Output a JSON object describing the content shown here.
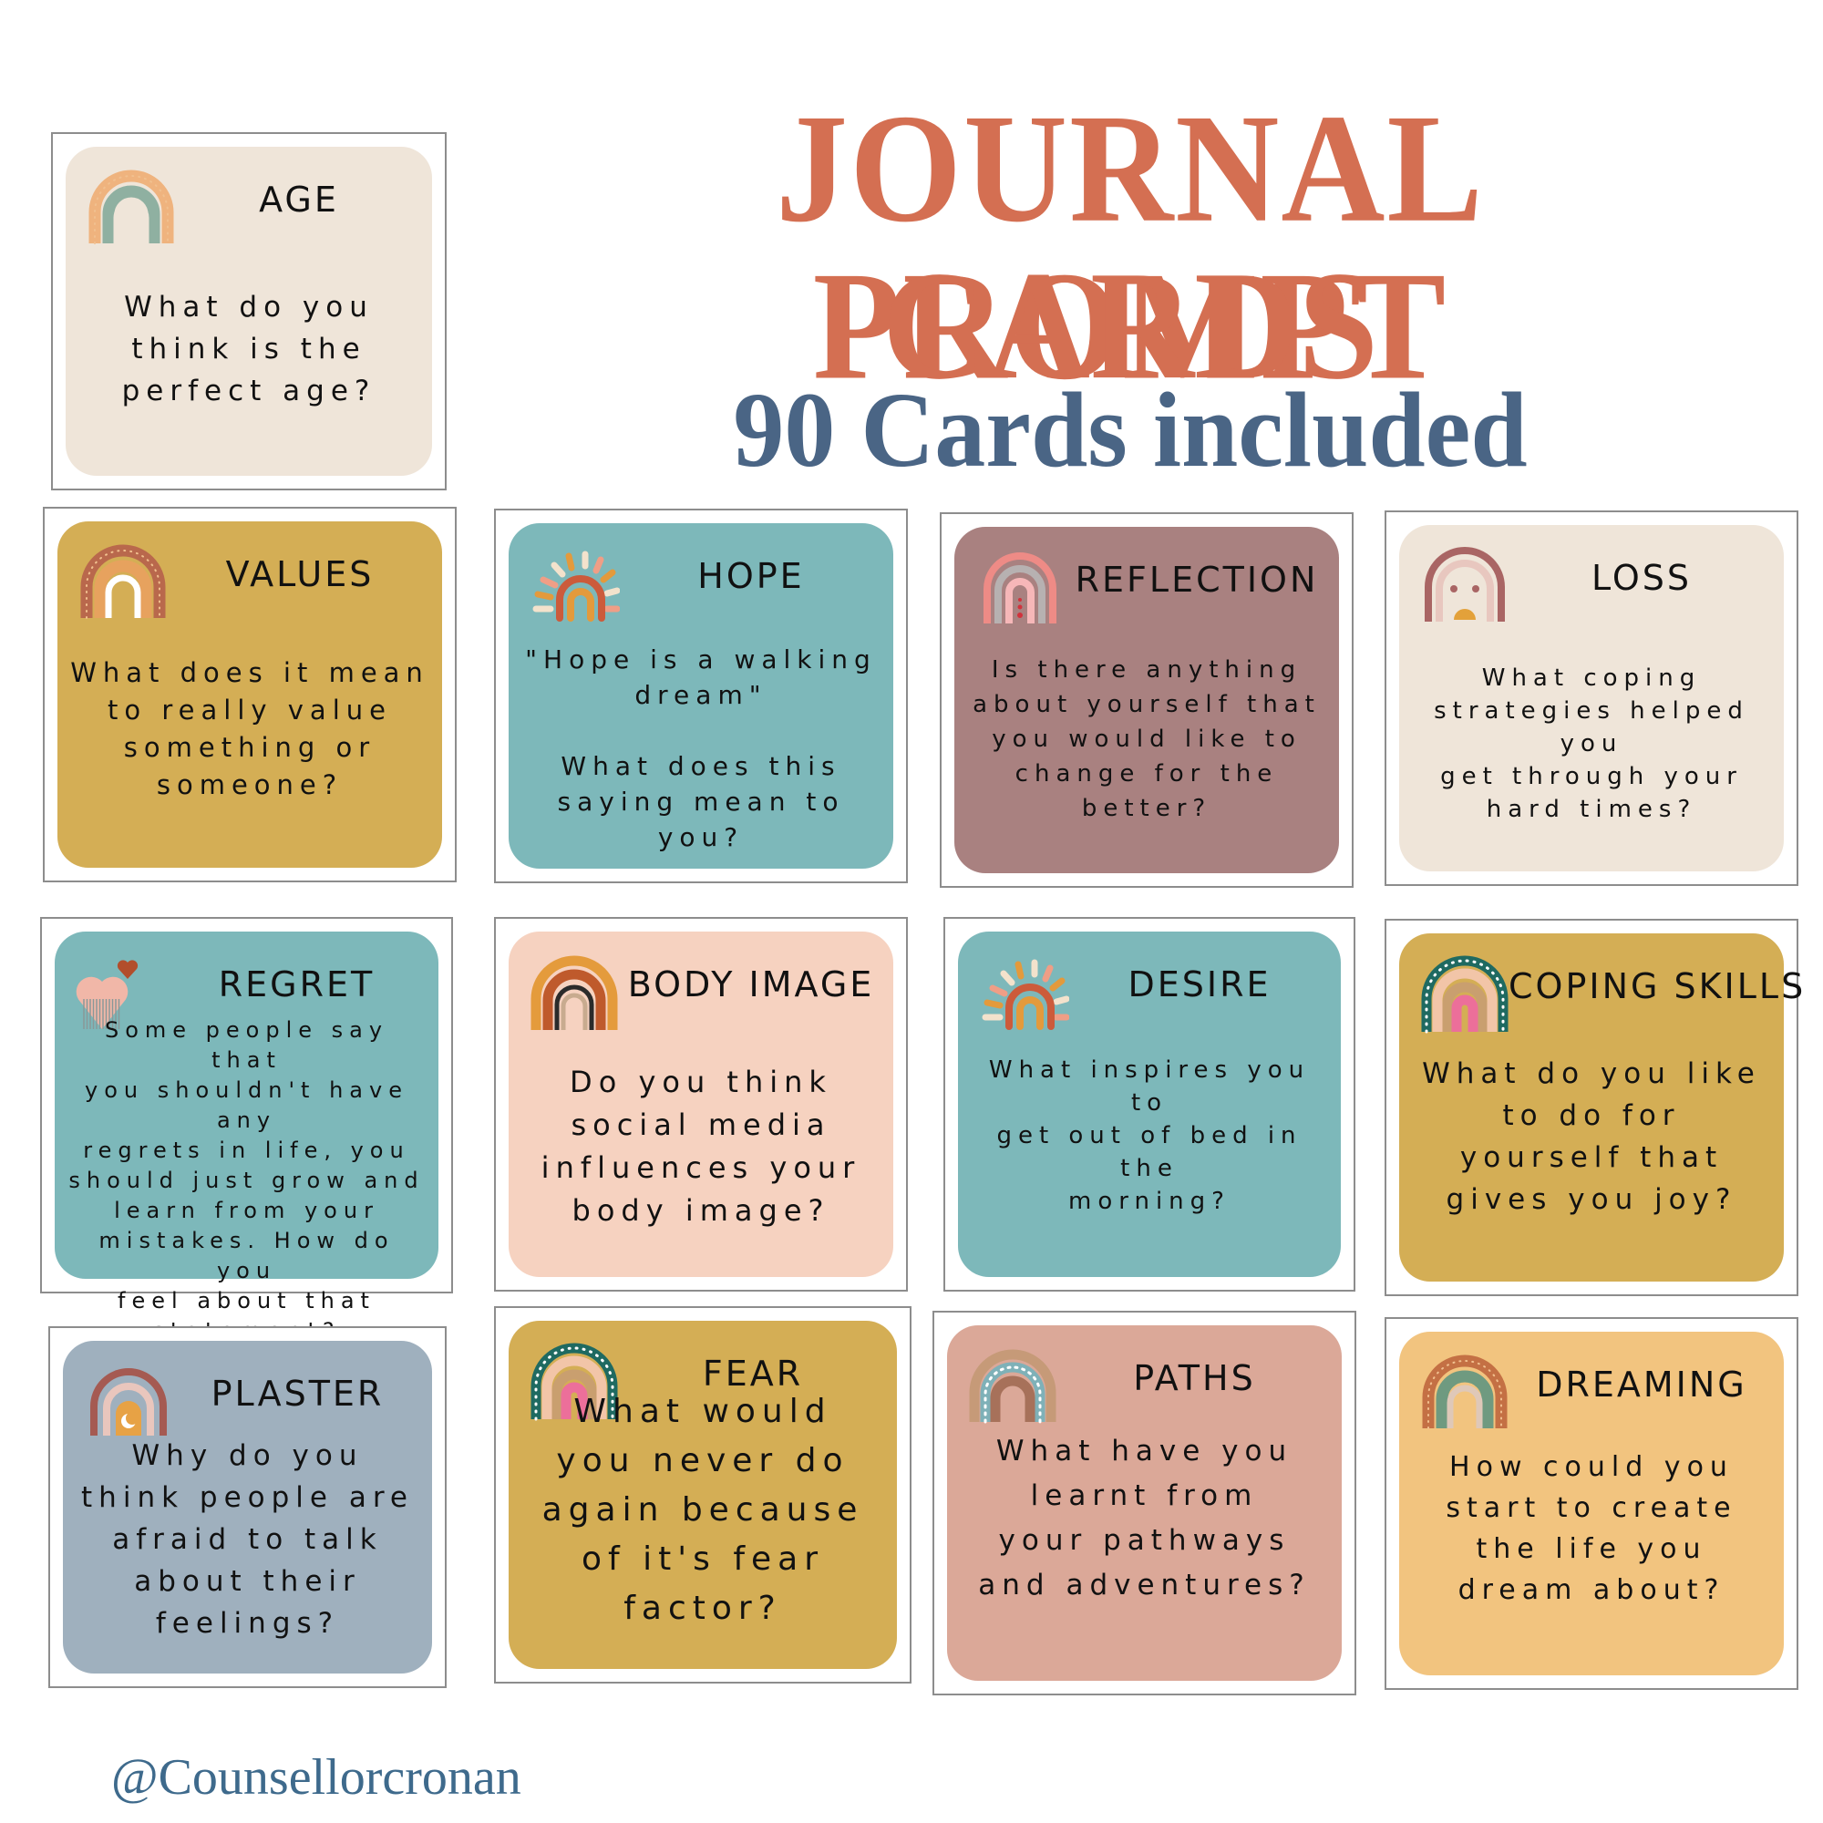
{
  "header": {
    "title_line1": "JOURNAL PROMPT",
    "title_line2": "CARDS",
    "subtitle": "90 Cards included"
  },
  "footer": {
    "handle": "@Counsellorcronan"
  },
  "colors": {
    "title": "#d46f52",
    "subtitle": "#4a6585",
    "handle": "#3e6a8c"
  },
  "cards": [
    {
      "title": "AGE",
      "prompt": "What do you\nthink is the\nperfect age?",
      "bg": "#efe5d9",
      "icon": "rainbow-dotted-icon"
    },
    {
      "title": "VALUES",
      "prompt": "What does it mean\nto really value\nsomething or\nsomeone?",
      "bg": "#d4ae55",
      "icon": "rainbow-dotted-icon"
    },
    {
      "title": "HOPE",
      "prompt": "\"Hope is a walking\ndream\"\n\nWhat does this\nsaying mean to you?",
      "bg": "#7db8ba",
      "icon": "sunburst-rainbow-icon"
    },
    {
      "title": "REFLECTION",
      "prompt": "Is there anything\nabout yourself that\nyou would like to\nchange for the\nbetter?",
      "bg": "#a98180",
      "icon": "rainbow-hearts-icon"
    },
    {
      "title": "LOSS",
      "prompt": "What coping\nstrategies helped you\nget through your\nhard times?",
      "bg": "#efe5d9",
      "icon": "rainbow-sun-icon"
    },
    {
      "title": "REGRET",
      "prompt": "Some people say that\nyou shouldn't have any\nregrets in life, you\nshould just grow and\nlearn from your\nmistakes. How do you\nfeel about that\nstatement?",
      "bg": "#7db8ba",
      "icon": "heart-icon"
    },
    {
      "title": "BODY IMAGE",
      "prompt": "Do you think\nsocial media\ninfluences your\nbody image?",
      "bg": "#f6d2c0",
      "icon": "boho-rainbow-icon"
    },
    {
      "title": "DESIRE",
      "prompt": "What inspires you to\nget out of bed in the\nmorning?",
      "bg": "#7db8ba",
      "icon": "sunburst-rainbow-icon"
    },
    {
      "title": "COPING SKILLS",
      "prompt": "What do you like\nto do for\nyourself that\ngives you joy?",
      "bg": "#d4ae55",
      "icon": "rainbow-dots-pink-icon"
    },
    {
      "title": "PLASTER",
      "prompt": "Why do you\nthink people are\nafraid to talk\nabout their\nfeelings?",
      "bg": "#9fb0be",
      "icon": "rainbow-moon-icon"
    },
    {
      "title": "FEAR",
      "prompt": "What would\nyou never do\nagain because\nof it's fear\nfactor?",
      "bg": "#d4ae55",
      "icon": "rainbow-dots-pink-icon"
    },
    {
      "title": "PATHS",
      "prompt": "What have you\nlearnt from\nyour pathways\nand adventures?",
      "bg": "#dba898",
      "icon": "rainbow-swirl-icon"
    },
    {
      "title": "DREAMING",
      "prompt": "How could you\nstart to create\nthe life you\ndream about?",
      "bg": "#f2c47f",
      "icon": "rainbow-dotted-icon"
    }
  ]
}
